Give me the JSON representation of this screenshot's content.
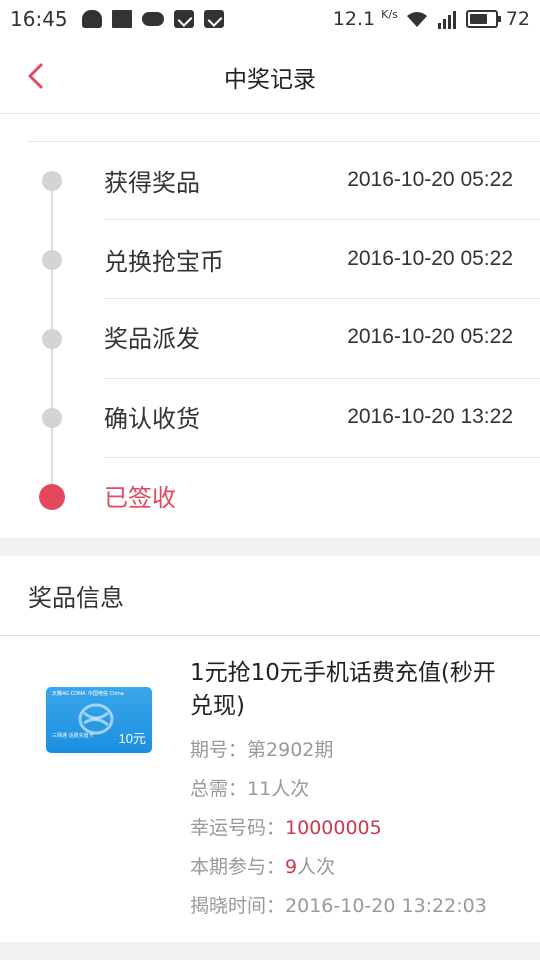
{
  "status_bar": {
    "time": "16:45",
    "speed": "12.1",
    "speed_unit": "K/s",
    "battery": "72",
    "battery_level": 0.72,
    "icons": [
      "notification-icon",
      "clapperboard-icon",
      "gamepad-icon",
      "shield-icon",
      "shield-icon",
      "wifi-icon",
      "signal-4g-icon",
      "battery-icon"
    ]
  },
  "header": {
    "title": "中奖记录",
    "back_icon": "chevron-left-icon"
  },
  "timeline": {
    "steps": [
      {
        "label": "获得奖品",
        "time": "2016-10-20 05:22"
      },
      {
        "label": "兑换抢宝币",
        "time": "2016-10-20 05:22"
      },
      {
        "label": "奖品派发",
        "time": "2016-10-20 05:22"
      },
      {
        "label": "确认收货",
        "time": "2016-10-20 13:22"
      },
      {
        "label": "已签收",
        "time": ""
      }
    ],
    "active_color": "#e3475d"
  },
  "prize_info": {
    "section_title": "奖品信息",
    "title": "1元抢10元手机话费充值(秒开兑现)",
    "period_label": "期号：",
    "period_value": "第2902期",
    "total_label": "总需：",
    "total_value": "11人次",
    "lucky_label": "幸运号码：",
    "lucky_value": "10000005",
    "participate_label": "本期参与：",
    "participate_num": "9",
    "participate_unit": "人次",
    "reveal_label": "揭晓时间：",
    "reveal_value": "2016-10-20 13:22:03",
    "card": {
      "top_left": "天翼4G CDMA",
      "top_right": "中国电信 China",
      "bottom_left": "三网通 话费充值卡",
      "value": "10元"
    },
    "accent_red": "#c83a4c"
  }
}
